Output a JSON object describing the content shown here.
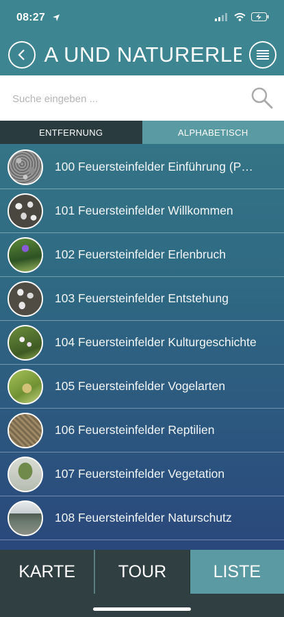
{
  "status": {
    "time": "08:27"
  },
  "header": {
    "title": "FLORA UND NATURERLEBNIS"
  },
  "search": {
    "placeholder": "Suche eingeben ..."
  },
  "segments": {
    "left": "ENTFERNUNG",
    "right": "ALPHABETISCH"
  },
  "list": [
    {
      "label": "100 Feuersteinfelder Einführung (P…",
      "thumb": "gravel"
    },
    {
      "label": "101 Feuersteinfelder Willkommen",
      "thumb": "stones"
    },
    {
      "label": "102 Feuersteinfelder Erlenbruch",
      "thumb": "flower"
    },
    {
      "label": "103 Feuersteinfelder Entstehung",
      "thumb": "stones"
    },
    {
      "label": "104 Feuersteinfelder Kulturgeschichte",
      "thumb": "flowers-white"
    },
    {
      "label": "105 Feuersteinfelder Vogelarten",
      "thumb": "bird"
    },
    {
      "label": "106 Feuersteinfelder Reptilien",
      "thumb": "reptile"
    },
    {
      "label": "107 Feuersteinfelder Vegetation",
      "thumb": "moss"
    },
    {
      "label": "108 Feuersteinfelder Naturschutz",
      "thumb": "landscape"
    }
  ],
  "tabs": {
    "karte": "KARTE",
    "tour": "TOUR",
    "liste": "LISTE"
  },
  "colors": {
    "header": "#3c8591",
    "tab_active": "#5c9aa3",
    "tab_inactive": "#303f42"
  }
}
